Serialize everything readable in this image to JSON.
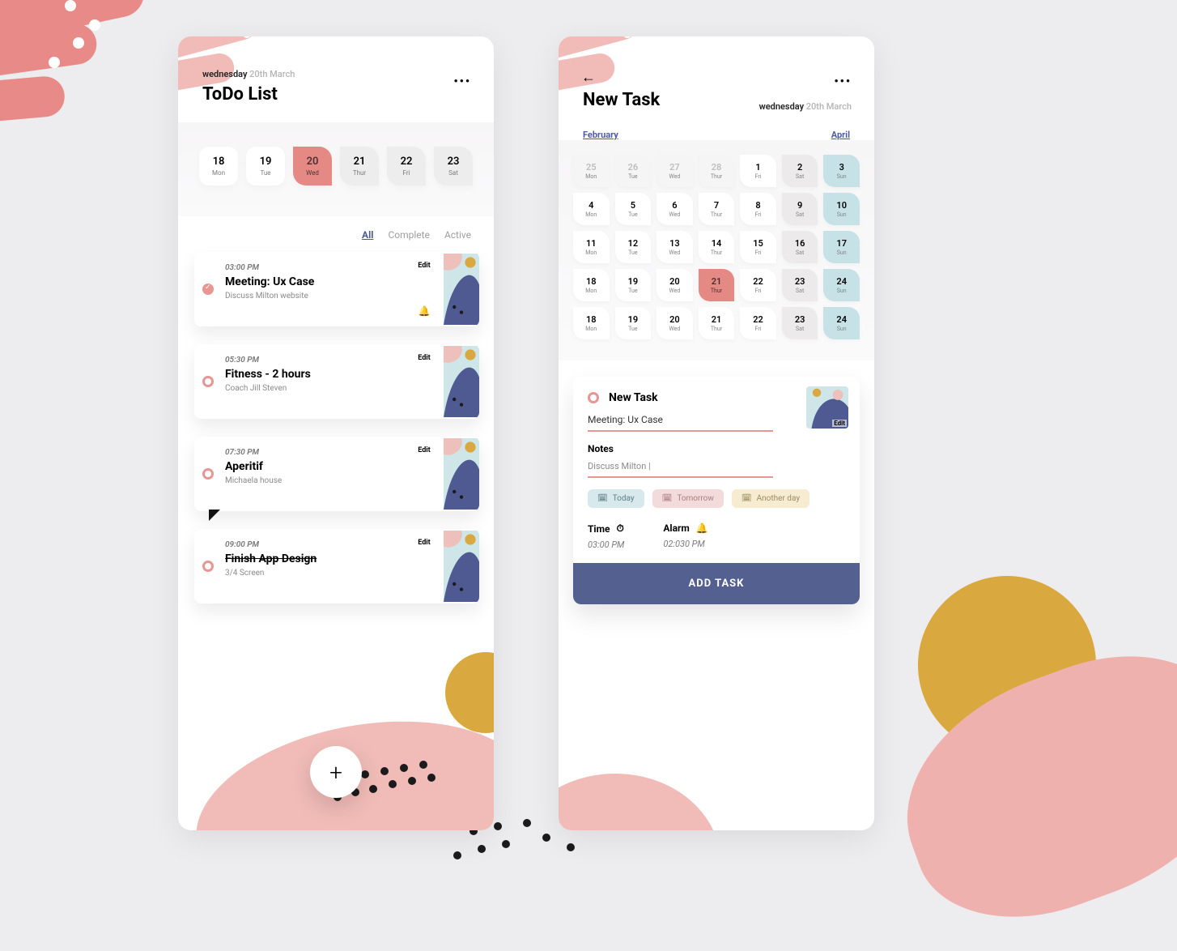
{
  "left": {
    "date_day": "wednesday",
    "date_rest": "20th March",
    "title": "ToDo List",
    "week": [
      {
        "num": "18",
        "lab": "Mon",
        "cls": ""
      },
      {
        "num": "19",
        "lab": "Tue",
        "cls": ""
      },
      {
        "num": "20",
        "lab": "Wed",
        "cls": "sel shape"
      },
      {
        "num": "21",
        "lab": "Thur",
        "cls": "grey shape"
      },
      {
        "num": "22",
        "lab": "Fri",
        "cls": "grey shape"
      },
      {
        "num": "23",
        "lab": "Sat",
        "cls": "grey shape"
      }
    ],
    "filters": {
      "all": "All",
      "complete": "Complete",
      "active": "Active"
    },
    "tasks": [
      {
        "time": "03:00 PM",
        "title": "Meeting: Ux Case",
        "sub": "Discuss Milton website",
        "edit": "Edit",
        "checked": true,
        "bell": true,
        "strike": false,
        "corner": false
      },
      {
        "time": "05:30 PM",
        "title": "Fitness - 2 hours",
        "sub": "Coach Jill Steven",
        "edit": "Edit",
        "checked": false,
        "bell": false,
        "strike": false,
        "corner": false
      },
      {
        "time": "07:30 PM",
        "title": "Aperitif",
        "sub": "Michaela house",
        "edit": "Edit",
        "checked": false,
        "bell": false,
        "strike": false,
        "corner": true
      },
      {
        "time": "09:00 PM",
        "title": "Finish App Design",
        "sub": "3/4 Screen",
        "edit": "Edit",
        "checked": false,
        "bell": false,
        "strike": true,
        "corner": false
      }
    ],
    "fab": "+"
  },
  "right": {
    "title": "New Task",
    "date_day": "wednesday",
    "date_rest": "20th March",
    "prev_month": "February",
    "next_month": "April",
    "calendar": [
      {
        "n": "25",
        "l": "Mon",
        "cls": "mute"
      },
      {
        "n": "26",
        "l": "Tue",
        "cls": "mute"
      },
      {
        "n": "27",
        "l": "Wed",
        "cls": "mute"
      },
      {
        "n": "28",
        "l": "Thur",
        "cls": "mute"
      },
      {
        "n": "1",
        "l": "Fri",
        "cls": ""
      },
      {
        "n": "2",
        "l": "Sat",
        "cls": "grey"
      },
      {
        "n": "3",
        "l": "Sun",
        "cls": "blue"
      },
      {
        "n": "4",
        "l": "Mon",
        "cls": ""
      },
      {
        "n": "5",
        "l": "Tue",
        "cls": ""
      },
      {
        "n": "6",
        "l": "Wed",
        "cls": ""
      },
      {
        "n": "7",
        "l": "Thur",
        "cls": ""
      },
      {
        "n": "8",
        "l": "Fri",
        "cls": ""
      },
      {
        "n": "9",
        "l": "Sat",
        "cls": "grey"
      },
      {
        "n": "10",
        "l": "Sun",
        "cls": "blue"
      },
      {
        "n": "11",
        "l": "Mon",
        "cls": ""
      },
      {
        "n": "12",
        "l": "Tue",
        "cls": ""
      },
      {
        "n": "13",
        "l": "Wed",
        "cls": ""
      },
      {
        "n": "14",
        "l": "Thur",
        "cls": ""
      },
      {
        "n": "15",
        "l": "Fri",
        "cls": ""
      },
      {
        "n": "16",
        "l": "Sat",
        "cls": "grey"
      },
      {
        "n": "17",
        "l": "Sun",
        "cls": "blue"
      },
      {
        "n": "18",
        "l": "Mon",
        "cls": ""
      },
      {
        "n": "19",
        "l": "Tue",
        "cls": ""
      },
      {
        "n": "20",
        "l": "Wed",
        "cls": ""
      },
      {
        "n": "21",
        "l": "Thur",
        "cls": "sel"
      },
      {
        "n": "22",
        "l": "Fri",
        "cls": ""
      },
      {
        "n": "23",
        "l": "Sat",
        "cls": "grey"
      },
      {
        "n": "24",
        "l": "Sun",
        "cls": "blue"
      },
      {
        "n": "18",
        "l": "Mon",
        "cls": ""
      },
      {
        "n": "19",
        "l": "Tue",
        "cls": ""
      },
      {
        "n": "20",
        "l": "Wed",
        "cls": ""
      },
      {
        "n": "21",
        "l": "Thur",
        "cls": ""
      },
      {
        "n": "22",
        "l": "Fri",
        "cls": ""
      },
      {
        "n": "23",
        "l": "Sat",
        "cls": "grey"
      },
      {
        "n": "24",
        "l": "Sun",
        "cls": "blue"
      }
    ],
    "panel": {
      "heading": "New Task",
      "task_name": "Meeting: Ux Case",
      "notes_label": "Notes",
      "notes_value": "Discuss Milton |",
      "edit": "Edit",
      "chips": {
        "today": "Today",
        "tomorrow": "Tomorrow",
        "another": "Another day"
      },
      "time_label": "Time",
      "time_value": "03:00 PM",
      "alarm_label": "Alarm",
      "alarm_value": "02:030 PM",
      "button": "ADD TASK"
    }
  }
}
